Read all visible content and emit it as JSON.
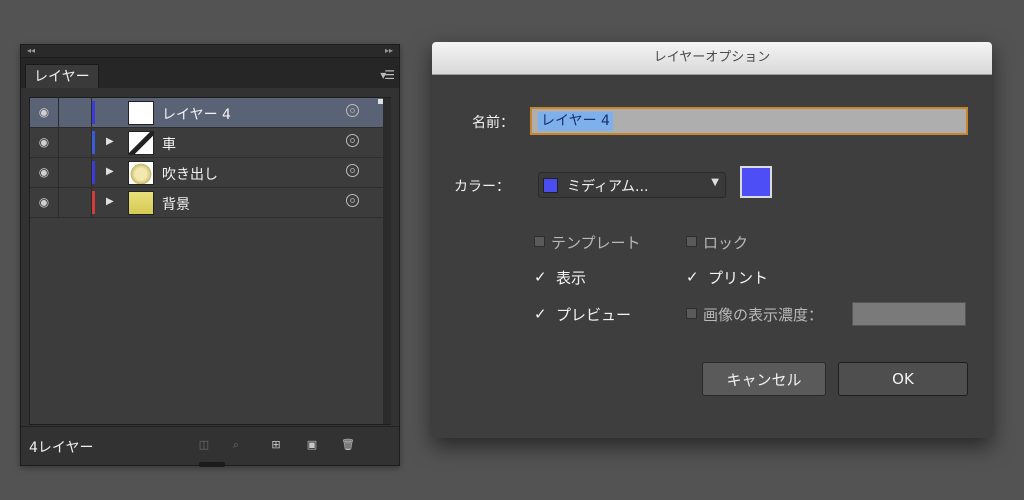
{
  "layers_panel": {
    "tab_label": "レイヤー",
    "layers": [
      {
        "name": "レイヤー 4",
        "color": "#3b3bd6",
        "selected": true,
        "has_arrow": false,
        "thumb": "white"
      },
      {
        "name": "車",
        "color": "#3b5bd6",
        "selected": false,
        "has_arrow": true,
        "thumb": "car"
      },
      {
        "name": "吹き出し",
        "color": "#3b3bd6",
        "selected": false,
        "has_arrow": true,
        "thumb": "bubble"
      },
      {
        "name": "背景",
        "color": "#d43b3b",
        "selected": false,
        "has_arrow": true,
        "thumb": "bg"
      }
    ],
    "layer_count_label": "4レイヤー",
    "footer_icons": [
      "make-clipping-mask-icon",
      "locate-object-icon",
      "new-sublayer-icon",
      "new-layer-icon",
      "trash-icon"
    ]
  },
  "dialog": {
    "title": "レイヤーオプション",
    "name_label": "名前：",
    "name_value": "レイヤー 4",
    "color_label": "カラー：",
    "color_value": "ミディアム...",
    "color_hex": "#4e4ef6",
    "options": {
      "template": "テンプレート",
      "lock": "ロック",
      "show": "表示",
      "print": "プリント",
      "preview": "プレビュー",
      "dim_images": "画像の表示濃度："
    },
    "cancel_label": "キャンセル",
    "ok_label": "OK"
  }
}
